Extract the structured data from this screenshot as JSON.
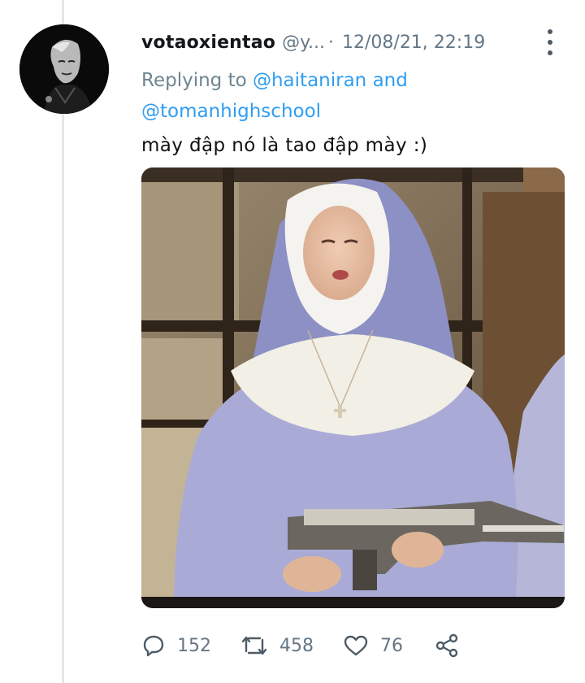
{
  "tweet": {
    "display_name": "votaoxientao",
    "handle": "@y...",
    "separator": "·",
    "timestamp": "12/08/21, 22:19",
    "replying_prefix": "Replying to",
    "replying_mention_1": "@haitaniran",
    "replying_conjunction": "and",
    "replying_mention_2": "@tomanhighschool",
    "text": "mày đập nó là tao đập mày :)"
  },
  "actions": {
    "replies": "152",
    "retweets": "458",
    "likes": "76"
  },
  "icons": {
    "more": "more-vertical-icon",
    "reply": "reply-bubble-icon",
    "retweet": "retweet-icon",
    "like": "heart-icon",
    "share": "share-icon"
  },
  "colors": {
    "mention": "#2f9df0",
    "muted": "#657786",
    "thread_line": "#e3e7eb"
  }
}
